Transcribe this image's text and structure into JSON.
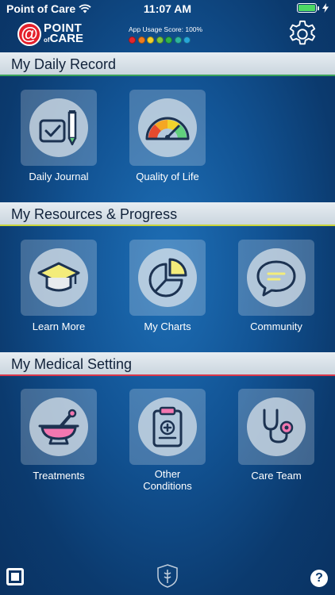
{
  "status_bar": {
    "carrier": "Point of Care",
    "time": "11:07 AM"
  },
  "header": {
    "logo_letter": "@",
    "logo_line1": "POINT",
    "logo_of": "of",
    "logo_line2": "CARE",
    "usage_label": "App Usage Score: 100%",
    "usage_dots": [
      "#e3262d",
      "#f07c1d",
      "#f3d12b",
      "#7cc63e",
      "#2fb34a",
      "#2db5a0",
      "#27a6d9"
    ]
  },
  "sections": [
    {
      "title": "My Daily Record",
      "accent": "#3aa35a",
      "tiles": [
        {
          "label": "Daily Journal",
          "icon": "journal-icon"
        },
        {
          "label": "Quality of Life",
          "icon": "gauge-icon"
        }
      ]
    },
    {
      "title": "My Resources & Progress",
      "accent": "#c9d53b",
      "tiles": [
        {
          "label": "Learn More",
          "icon": "graduation-cap-icon"
        },
        {
          "label": "My Charts",
          "icon": "pie-chart-icon"
        },
        {
          "label": "Community",
          "icon": "chat-bubble-icon"
        }
      ]
    },
    {
      "title": "My Medical Setting",
      "accent": "#d9374b",
      "tiles": [
        {
          "label": "Treatments",
          "icon": "mortar-pestle-icon"
        },
        {
          "label_line1": "Other",
          "label_line2": "Conditions",
          "icon": "clipboard-icon"
        },
        {
          "label": "Care Team",
          "icon": "stethoscope-icon"
        }
      ]
    }
  ],
  "footer": {
    "help": "?"
  }
}
